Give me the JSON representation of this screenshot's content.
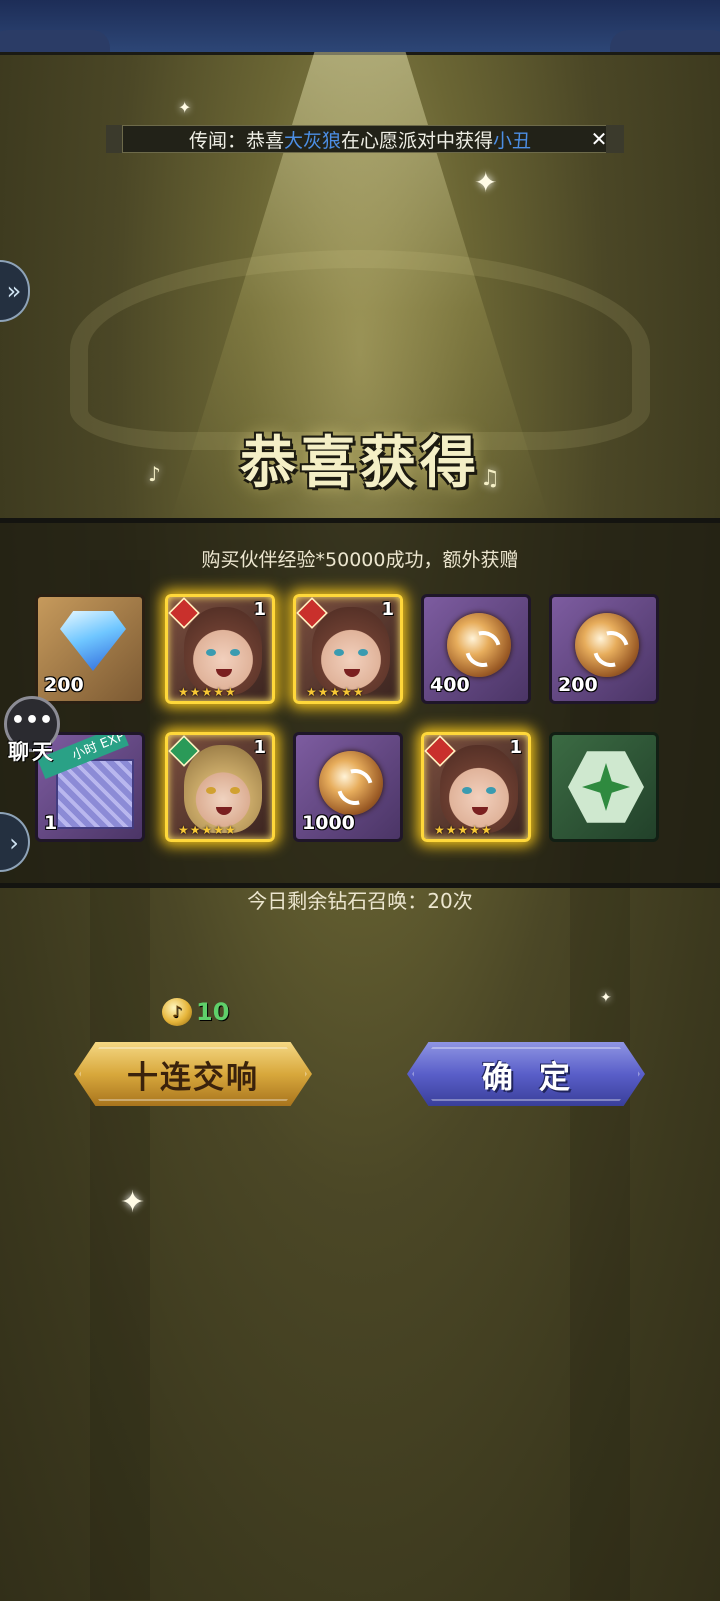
{
  "ticker": {
    "prefix": "传闻：恭喜",
    "player": "大灰狼",
    "middle": "在心愿派对中获得",
    "reward": "小丑"
  },
  "title": "恭喜获得",
  "message": "购买伙伴经验*50000成功，额外获赠",
  "items": [
    {
      "kind": "diamond",
      "qty": "200"
    },
    {
      "kind": "hero-fire",
      "level": "1",
      "stars": "★★★★★"
    },
    {
      "kind": "hero-fire",
      "level": "1",
      "stars": "★★★★★"
    },
    {
      "kind": "orb",
      "qty": "400"
    },
    {
      "kind": "orb",
      "qty": "200"
    },
    {
      "kind": "exp-gift",
      "qty": "1",
      "tag": "小时 EXP"
    },
    {
      "kind": "hero-wind",
      "level": "1",
      "stars": "★★★★★"
    },
    {
      "kind": "orb",
      "qty": "1000"
    },
    {
      "kind": "hero-fire",
      "level": "1",
      "stars": "★★★★★"
    },
    {
      "kind": "sigil"
    }
  ],
  "chat": {
    "icon": "•••",
    "label": "聊天"
  },
  "remaining": "今日剩余钻石召唤：20次",
  "cost": {
    "icon": "♪",
    "amount": "10"
  },
  "buttons": {
    "ten_pull": "十连交响",
    "confirm": "确定"
  },
  "colors": {
    "ticker_highlight": "#4c8ee4",
    "cost_text": "#5fd06a",
    "hero_glow": "#ffd83a"
  }
}
